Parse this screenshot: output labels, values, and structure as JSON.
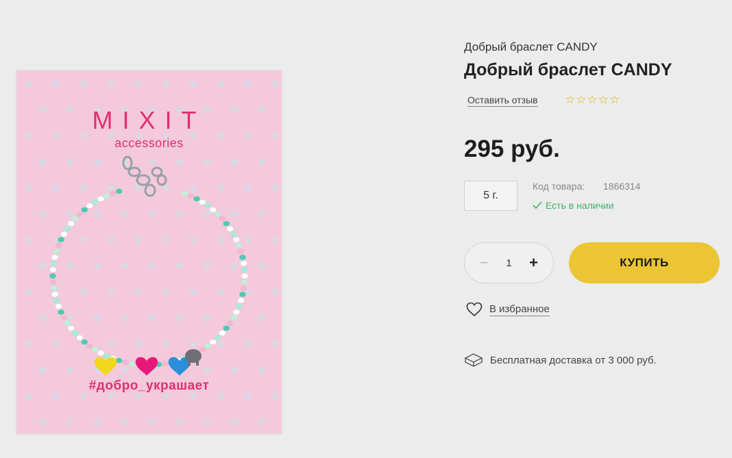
{
  "image": {
    "brand": "MIXIT",
    "brand_sub": "accessories",
    "hashtag": "#добро_украшает"
  },
  "product": {
    "subtitle": "Добрый браслет CANDY",
    "title": "Добрый браслет CANDY",
    "review_link": "Оставить отзыв",
    "rating_stars": "☆☆☆☆☆",
    "price": "295 руб.",
    "weight": "5 г.",
    "code_label": "Код товара:",
    "code_value": "1866314",
    "stock": "Есть в наличии",
    "quantity": "1",
    "minus": "−",
    "plus": "+",
    "buy_label": "КУПИТЬ",
    "favorite_label": "В избранное",
    "delivery": "Бесплатная доставка от 3 000 руб."
  },
  "colors": {
    "buy_button": "#ecc535",
    "stock_green": "#3bb36a",
    "brand_pink": "#e0306b",
    "card_bg": "#f4c9dc"
  }
}
